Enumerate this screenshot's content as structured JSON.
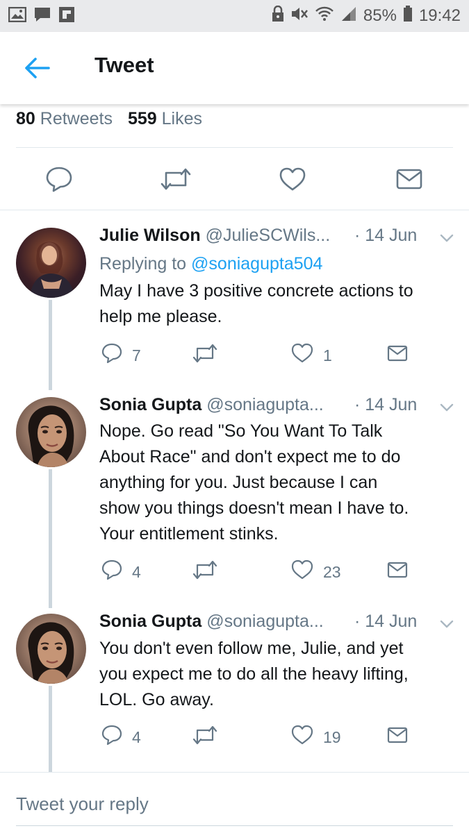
{
  "status_bar": {
    "battery": "85%",
    "time": "19:42"
  },
  "header": {
    "title": "Tweet"
  },
  "stats": {
    "retweets_count": "80",
    "retweets_label": "Retweets",
    "likes_count": "559",
    "likes_label": "Likes"
  },
  "replies": [
    {
      "name": "Julie Wilson",
      "handle": "@JulieSCWils...",
      "date": "· 14 Jun",
      "replying_prefix": "Replying to",
      "replying_to": "@soniagupta504",
      "text_lines": [
        "May I have 3 positive concrete actions to",
        "help me please."
      ],
      "replies": "7",
      "retweets": "",
      "likes": "1"
    },
    {
      "name": "Sonia Gupta",
      "handle": "@soniagupta...",
      "date": "· 14 Jun",
      "text_lines": [
        "Nope. Go read \"So You Want To Talk",
        "About Race\" and don't expect me to do",
        "anything for you. Just because I can",
        "show you things doesn't mean I have to.",
        "Your entitlement stinks."
      ],
      "replies": "4",
      "retweets": "",
      "likes": "23"
    },
    {
      "name": "Sonia Gupta",
      "handle": "@soniagupta...",
      "date": "· 14 Jun",
      "text_lines": [
        "You don't even follow me, Julie, and yet",
        "you expect me to do all the heavy lifting,",
        "LOL. Go away."
      ],
      "replies": "4",
      "retweets": "",
      "likes": "19"
    }
  ],
  "reply_input": {
    "placeholder": "Tweet your reply"
  },
  "colors": {
    "accent": "#1da1f2",
    "secondary_text": "#657786",
    "primary_text": "#14171a",
    "thread_line": "#ccd6dd"
  },
  "icons": [
    "gallery-icon",
    "chat-icon",
    "flipboard-icon",
    "lock-icon",
    "mute-icon",
    "wifi-icon",
    "signal-icon",
    "battery-icon",
    "back-arrow-icon",
    "reply-icon",
    "retweet-icon",
    "like-icon",
    "share-icon",
    "chevron-down-icon"
  ]
}
